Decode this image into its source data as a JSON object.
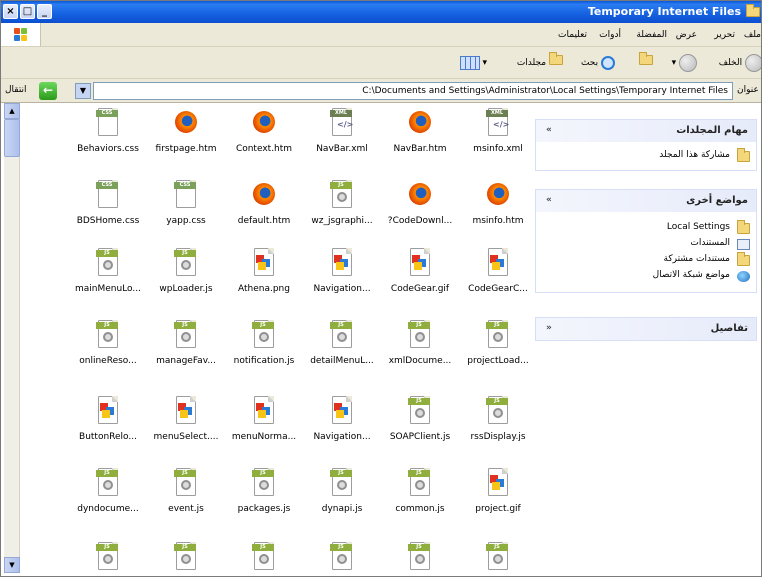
{
  "window": {
    "title": "Temporary Internet Files"
  },
  "titlebar_buttons": {
    "close": "×",
    "maximize": "□",
    "minimize": "_"
  },
  "menu": {
    "items": [
      "ملف",
      "تحرير",
      "عرض",
      "المفضلة",
      "أدوات",
      "تعليمات"
    ]
  },
  "toolbar": {
    "back": "الخلف",
    "search": "بحث",
    "folders": "مجلدات"
  },
  "address": {
    "label": "عنوان",
    "path": "C:\\Documents and Settings\\Administrator\\Local Settings\\Temporary Internet Files",
    "go": "انتقال"
  },
  "tasks": {
    "folder_tasks": {
      "header": "مهام المجلدات",
      "items": [
        "مشاركة هذا المجلد"
      ]
    },
    "other_places": {
      "header": "مواضع أخرى",
      "items": [
        "Local Settings",
        "المستندات",
        "مستندات مشتركة",
        "مواضع شبكة الاتصال"
      ]
    },
    "details": {
      "header": "تفاصيل"
    }
  },
  "files": [
    {
      "name": "Behaviors.css",
      "icon": "css-file-icon"
    },
    {
      "name": "firstpage.htm",
      "icon": "firefox-html-icon"
    },
    {
      "name": "Context.htm",
      "icon": "firefox-html-icon"
    },
    {
      "name": "NavBar.xml",
      "icon": "xml-file-icon"
    },
    {
      "name": "NavBar.htm",
      "icon": "firefox-html-icon"
    },
    {
      "name": "msinfo.xml",
      "icon": "xml-file-icon"
    },
    {
      "name": "BDSHome.css",
      "icon": "css-file-icon"
    },
    {
      "name": "yapp.css",
      "icon": "css-file-icon"
    },
    {
      "name": "default.htm",
      "icon": "firefox-html-icon"
    },
    {
      "name": "wz_jsgraphi...",
      "icon": "js-file-icon"
    },
    {
      "name": "?CodeDownl...",
      "icon": "firefox-html-icon"
    },
    {
      "name": "msinfo.htm",
      "icon": "firefox-html-icon"
    },
    {
      "name": "mainMenuLo...",
      "icon": "js-file-icon"
    },
    {
      "name": "wpLoader.js",
      "icon": "js-file-icon"
    },
    {
      "name": "Athena.png",
      "icon": "image-file-icon"
    },
    {
      "name": "Navigation...",
      "icon": "image-file-icon"
    },
    {
      "name": "CodeGear.gif",
      "icon": "image-file-icon"
    },
    {
      "name": "CodeGearC...",
      "icon": "image-file-icon"
    },
    {
      "name": "onlineReso...",
      "icon": "js-file-icon"
    },
    {
      "name": "manageFav...",
      "icon": "js-file-icon"
    },
    {
      "name": "notification.js",
      "icon": "js-file-icon"
    },
    {
      "name": "detailMenuL...",
      "icon": "js-file-icon"
    },
    {
      "name": "xmlDocume...",
      "icon": "js-file-icon"
    },
    {
      "name": "projectLoad...",
      "icon": "js-file-icon"
    },
    {
      "name": "ButtonRelo...",
      "icon": "image-file-icon"
    },
    {
      "name": "menuSelect....",
      "icon": "image-file-icon"
    },
    {
      "name": "menuNorma...",
      "icon": "image-file-icon"
    },
    {
      "name": "Navigation...",
      "icon": "image-file-icon"
    },
    {
      "name": "SOAPClient.js",
      "icon": "js-file-icon"
    },
    {
      "name": "rssDisplay.js",
      "icon": "js-file-icon"
    },
    {
      "name": "dyndocume...",
      "icon": "js-file-icon"
    },
    {
      "name": "event.js",
      "icon": "js-file-icon"
    },
    {
      "name": "packages.js",
      "icon": "js-file-icon"
    },
    {
      "name": "dynapi.js",
      "icon": "js-file-icon"
    },
    {
      "name": "common.js",
      "icon": "js-file-icon"
    },
    {
      "name": "project.gif",
      "icon": "image-file-icon"
    },
    {
      "name": "",
      "icon": "js-file-icon"
    },
    {
      "name": "",
      "icon": "js-file-icon"
    },
    {
      "name": "",
      "icon": "js-file-icon"
    },
    {
      "name": "",
      "icon": "js-file-icon"
    },
    {
      "name": "",
      "icon": "js-file-icon"
    },
    {
      "name": "",
      "icon": "js-file-icon"
    }
  ],
  "colors": {
    "titlebar": "#1461e0",
    "panel_header": "#e6ebfa"
  }
}
